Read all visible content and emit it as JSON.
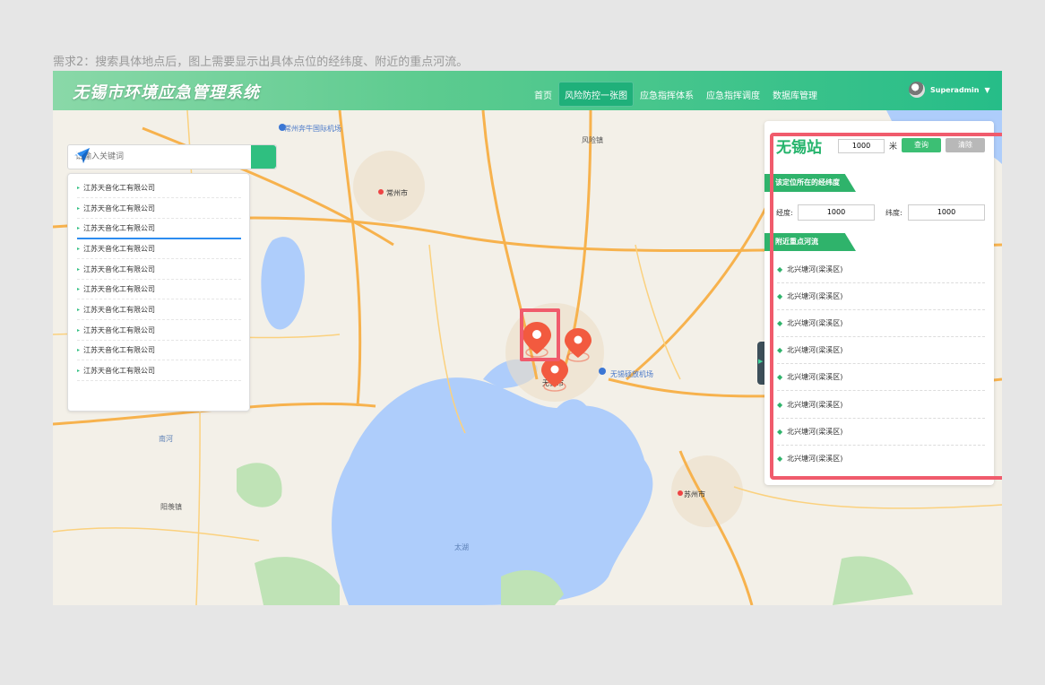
{
  "requirement_text": "需求2：搜索具体地点后，图上需要显示出具体点位的经纬度、附近的重点河流。",
  "app": {
    "title": "无锡市环境应急管理系统"
  },
  "nav": {
    "items": [
      "首页",
      "风险防控一张图",
      "应急指挥体系",
      "应急指挥调度",
      "数据库管理"
    ],
    "active_index": 1
  },
  "user": {
    "name": "Superadmin"
  },
  "search": {
    "placeholder": "请输入关键词"
  },
  "results": [
    "江苏天音化工有限公司",
    "江苏天音化工有限公司",
    "江苏天音化工有限公司",
    "江苏天音化工有限公司",
    "江苏天音化工有限公司",
    "江苏天音化工有限公司",
    "江苏天音化工有限公司",
    "江苏天音化工有限公司",
    "江苏天音化工有限公司",
    "江苏天音化工有限公司"
  ],
  "selected_result_index": 2,
  "panel": {
    "station": "无锡站",
    "range_value": "1000",
    "unit": "米",
    "query_label": "查询",
    "clear_label": "清除",
    "coord_section": "该定位所在的经纬度",
    "lng_label": "经度:",
    "lng_value": "1000",
    "lat_label": "纬度:",
    "lat_value": "1000",
    "river_section": "附近重点河流",
    "rivers": [
      "北兴塘河(梁溪区)",
      "北兴塘河(梁溪区)",
      "北兴塘河(梁溪区)",
      "北兴塘河(梁溪区)",
      "北兴塘河(梁溪区)",
      "北兴塘河(梁溪区)",
      "北兴塘河(梁溪区)",
      "北兴塘河(梁溪区)"
    ]
  },
  "map_labels": {
    "changzhou_airport": "常州奔牛国际机场",
    "changzhou": "常州市",
    "wuxi_airport": "无锡硕放机场",
    "wuxi": "无锡市",
    "suzhou": "苏州市",
    "taihu": "太湖",
    "nanhe": "南河",
    "fenglin": "风险镇",
    "yangxian": "阳羡镇"
  },
  "colors": {
    "brand": "#2fbf80",
    "highlight": "#f05b6c",
    "water": "#aecdfb",
    "selected_underline": "#2d8cf0"
  }
}
